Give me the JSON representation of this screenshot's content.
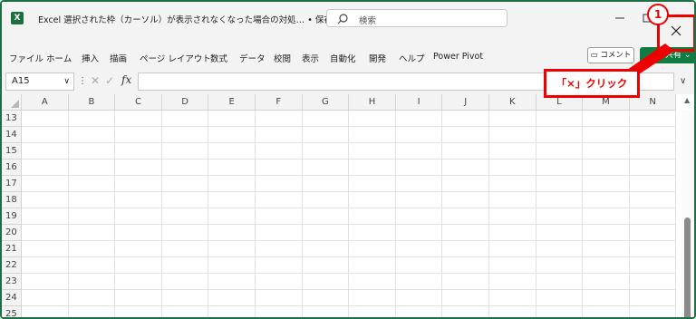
{
  "titlebar": {
    "logo": "X",
    "doc_title": "Excel 選択された枠（カーソル）が表示されなくなった場合の対処… • 保存済み ∨",
    "search_placeholder": "検索",
    "min_symbol": "—",
    "max_symbol": "☐",
    "close_symbol": "✕"
  },
  "menu": {
    "items": [
      "ファイル",
      "ホーム",
      "挿入",
      "描画",
      "ページ レイアウト",
      "数式",
      "データ",
      "校閲",
      "表示",
      "自動化",
      "開発",
      "ヘルプ",
      "Power Pivot"
    ],
    "comment_label": "コメント",
    "share_label": "共有"
  },
  "annotation": {
    "badge": "1",
    "callout_text": "「×」クリック"
  },
  "formula_bar": {
    "namebox": "A15",
    "fx": "fx"
  },
  "grid": {
    "columns": [
      "A",
      "B",
      "C",
      "D",
      "E",
      "F",
      "G",
      "H",
      "I",
      "J",
      "K",
      "L",
      "M",
      "N"
    ],
    "rows": [
      "13",
      "14",
      "15",
      "16",
      "17",
      "18",
      "19",
      "20",
      "21",
      "22",
      "23",
      "24",
      "25"
    ]
  }
}
